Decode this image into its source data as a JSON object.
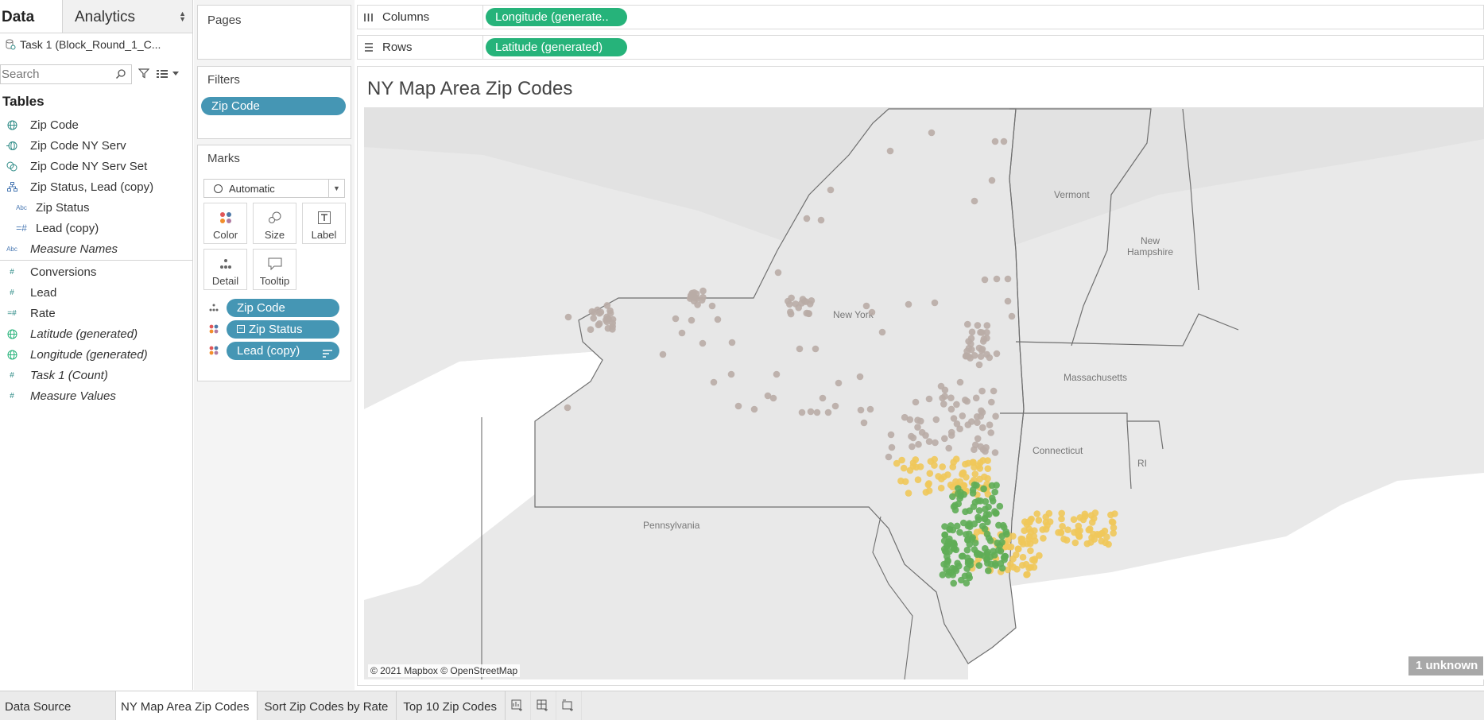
{
  "data_pane": {
    "tab_data": "Data",
    "tab_analytics": "Analytics",
    "datasource": "Task 1 (Block_Round_1_C...",
    "search_placeholder": "Search",
    "tables_heading": "Tables",
    "dimensions": [
      {
        "label": "Zip Code",
        "icon": "globe-icon"
      },
      {
        "label": "Zip Code NY Serv",
        "icon": "globe-plus-icon"
      },
      {
        "label": "Zip Code NY Serv Set",
        "icon": "set-icon"
      },
      {
        "label": "Zip Status, Lead (copy)",
        "icon": "hierarchy-icon"
      },
      {
        "label": "Zip Status",
        "icon": "abc-icon"
      },
      {
        "label": "Lead (copy)",
        "icon": "hash-icon"
      },
      {
        "label": "Measure Names",
        "icon": "abc-icon"
      }
    ],
    "measures": [
      {
        "label": "Conversions",
        "icon": "hash-icon"
      },
      {
        "label": "Lead",
        "icon": "hash-icon"
      },
      {
        "label": "Rate",
        "icon": "calc-hash-icon"
      },
      {
        "label": "Latitude (generated)",
        "icon": "globe-icon"
      },
      {
        "label": "Longitude (generated)",
        "icon": "globe-icon"
      },
      {
        "label": "Task 1 (Count)",
        "icon": "hash-icon"
      },
      {
        "label": "Measure Values",
        "icon": "hash-icon"
      }
    ]
  },
  "cards": {
    "pages_title": "Pages",
    "filters_title": "Filters",
    "filter_pill": "Zip Code",
    "marks_title": "Marks",
    "marks_type": "Automatic",
    "marks_buttons": {
      "color": "Color",
      "size": "Size",
      "label": "Label",
      "detail": "Detail",
      "tooltip": "Tooltip"
    },
    "mark_fields": [
      "Zip Code",
      "Zip Status",
      "Lead (copy)"
    ]
  },
  "shelves": {
    "columns_label": "Columns",
    "columns_pill": "Longitude (generate..",
    "rows_label": "Rows",
    "rows_pill": "Latitude (generated)"
  },
  "viz": {
    "title": "NY Map Area Zip Codes",
    "map_labels": {
      "vermont": "Vermont",
      "new": "New",
      "hampshire": "Hampshire",
      "new_york": "New York",
      "massachusetts": "Massachusetts",
      "connecticut": "Connecticut",
      "ri": "RI",
      "pennsylvania": "Pennsylvania"
    },
    "credit": "© 2021 Mapbox © OpenStreetMap",
    "unknown_badge": "1 unknown",
    "status_colors": {
      "default": "#b9aca6",
      "yellow": "#f0c85a",
      "green": "#5fad56"
    }
  },
  "sheet_tabs": {
    "data_source": "Data Source",
    "sheets": [
      "NY Map Area Zip Codes",
      "Sort Zip Codes by Rate",
      "Top 10 Zip Codes"
    ],
    "active": "NY Map Area Zip Codes"
  }
}
